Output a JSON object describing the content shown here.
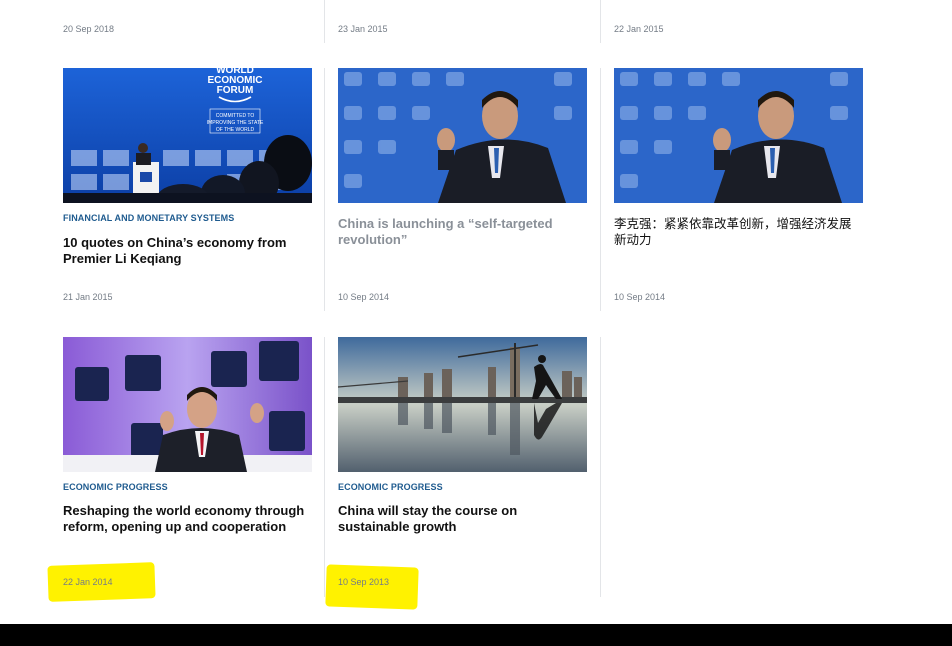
{
  "top_row_dates": [
    "20 Sep 2018",
    "23 Jan 2015",
    "22 Jan 2015"
  ],
  "cards": [
    {
      "image_icon": "image-wef-podium",
      "category": "FINANCIAL AND MONETARY SYSTEMS",
      "title": "10 quotes on China’s economy from Premier Li Keqiang",
      "date": "21 Jan 2015",
      "logo_text": [
        "WORLD",
        "ECONOMIC",
        "FORUM"
      ],
      "logo_tagline": [
        "COMMITTED TO",
        "IMPROVING THE STATE",
        "OF THE WORLD"
      ]
    },
    {
      "image_icon": "image-speaker-gesturing",
      "category": "",
      "title": "China is launching a “self-targeted revolution”",
      "date": "10 Sep 2014"
    },
    {
      "image_icon": "image-speaker-gesturing",
      "category": "",
      "title": "李克强：紧紧依靠改革创新，增强经济发展新动力",
      "date": "10 Sep 2014"
    },
    {
      "image_icon": "image-speaker-seated",
      "category": "ECONOMIC PROGRESS",
      "title": "Reshaping the world economy through reform, opening up and cooperation",
      "date": "22 Jan 2014"
    },
    {
      "image_icon": "image-city-skyline-reflection",
      "category": "ECONOMIC PROGRESS",
      "title": "China will stay the course on sustainable growth",
      "date": "10 Sep 2013"
    }
  ],
  "colors": {
    "category": "#1f5b8f",
    "title": "#111111",
    "title_muted": "#8a9098",
    "date": "#747c86",
    "highlight": "#fff200",
    "footer": "#000000"
  }
}
